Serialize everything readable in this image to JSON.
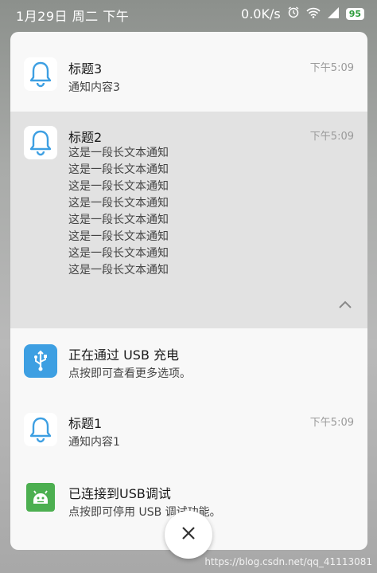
{
  "status_bar": {
    "datetime": "1月29日 周二 下午",
    "net_speed": "0.0K/s",
    "battery_level": "95"
  },
  "notifications": [
    {
      "icon": "bell-icon",
      "title": "标题3",
      "time": "下午5:09",
      "body": "通知内容3"
    },
    {
      "icon": "bell-icon",
      "title": "标题2",
      "time": "下午5:09",
      "lines": [
        "这是一段长文本通知",
        "这是一段长文本通知",
        "这是一段长文本通知",
        "这是一段长文本通知",
        "这是一段长文本通知",
        "这是一段长文本通知",
        "这是一段长文本通知",
        "这是一段长文本通知"
      ]
    },
    {
      "icon": "usb-icon",
      "title": "正在通过 USB 充电",
      "body": "点按即可查看更多选项。"
    },
    {
      "icon": "bell-icon",
      "title": "标题1",
      "time": "下午5:09",
      "body": "通知内容1"
    },
    {
      "icon": "android-icon",
      "title": "已连接到USB调试",
      "body": "点按即可停用 USB 调试功能。"
    }
  ],
  "watermark": "https://blog.csdn.net/qq_41113081",
  "colors": {
    "bell": "#3d9fe2",
    "usb_bg": "#3d9fe2",
    "android_bg": "#4caf50",
    "battery_text": "#2e9c3c"
  }
}
